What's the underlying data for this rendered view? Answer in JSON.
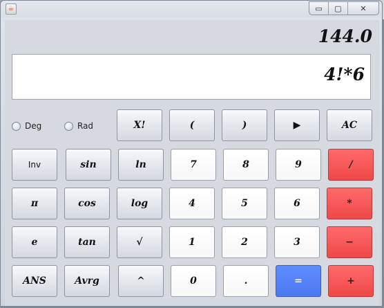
{
  "window": {
    "icon": "java-cup-icon",
    "controls": {
      "minimize": "▭",
      "maximize": "▢",
      "close": "✕"
    }
  },
  "display": {
    "result": "144.0",
    "expression": "4!*6"
  },
  "angle_mode": {
    "deg_label": "Deg",
    "rad_label": "Rad",
    "selected": ""
  },
  "colors": {
    "operator": "#f04848",
    "equals": "#4b78f0",
    "number": "#ffffff"
  },
  "buttons": {
    "factorial": "X!",
    "open_paren": "(",
    "close_paren": ")",
    "backspace": "▶",
    "clear": "AC",
    "inv": "Inv",
    "sin": "sin",
    "ln": "ln",
    "seven": "7",
    "eight": "8",
    "nine": "9",
    "divide": "/",
    "pi": "π",
    "cos": "cos",
    "log": "log",
    "four": "4",
    "five": "5",
    "six": "6",
    "multiply": "*",
    "e": "e",
    "tan": "tan",
    "sqrt": "√",
    "one": "1",
    "two": "2",
    "three": "3",
    "minus": "−",
    "ans": "ANS",
    "avrg": "Avrg",
    "power": "^",
    "zero": "0",
    "dot": ".",
    "equals": "=",
    "plus": "+"
  }
}
